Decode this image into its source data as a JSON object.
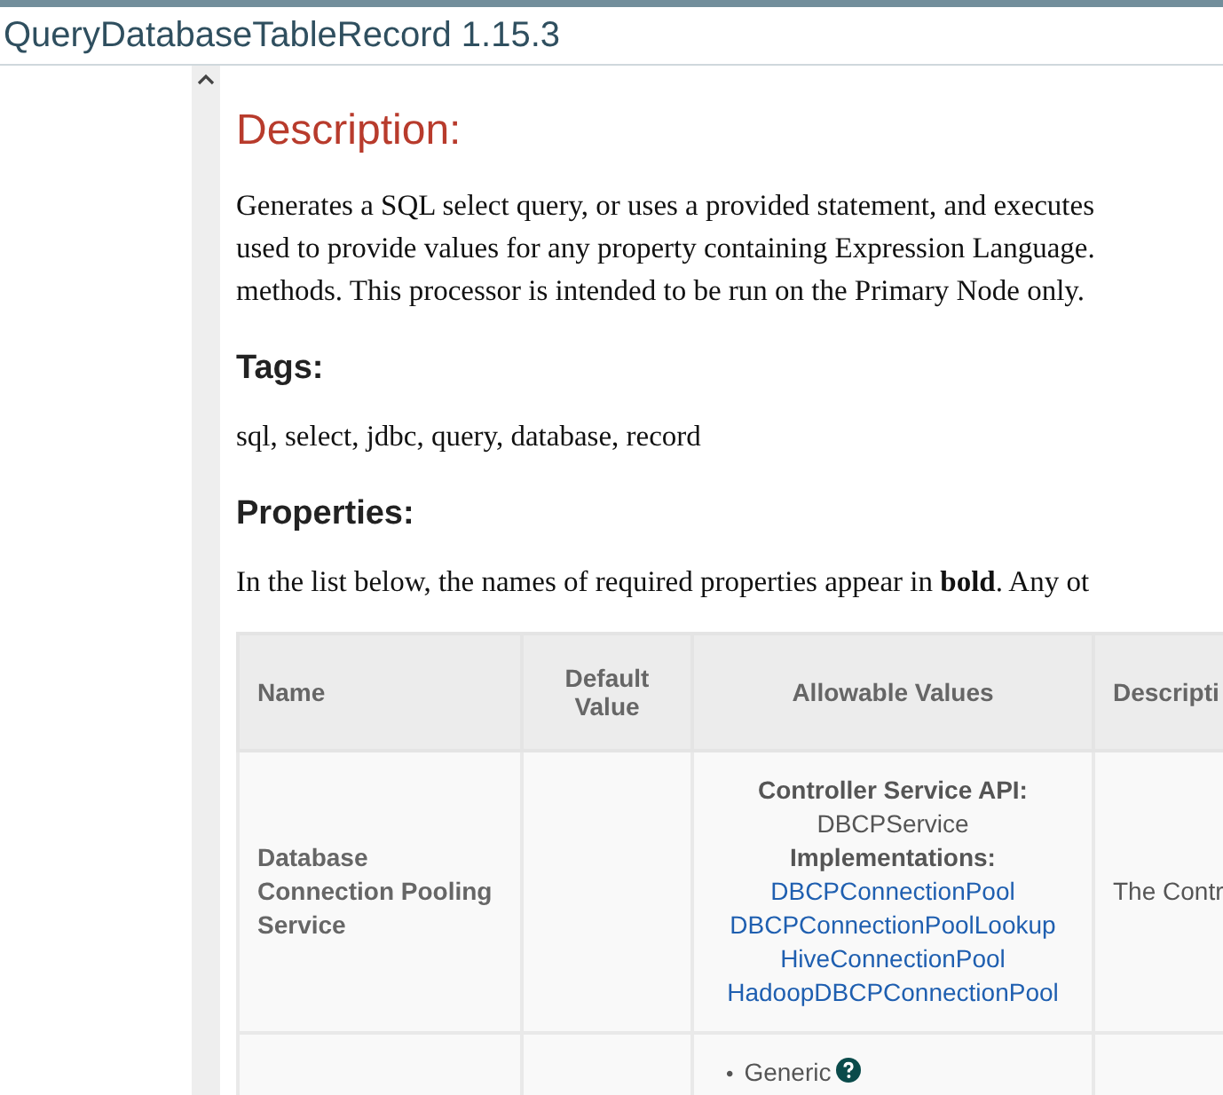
{
  "title": "QueryDatabaseTableRecord 1.15.3",
  "description": {
    "heading": "Description:",
    "lines": [
      "Generates a SQL select query, or uses a provided statement, and executes",
      "used to provide values for any property containing Expression Language.",
      "methods. This processor is intended to be run on the Primary Node only."
    ]
  },
  "tags": {
    "heading": "Tags:",
    "text": "sql, select, jdbc, query, database, record"
  },
  "properties": {
    "heading": "Properties:",
    "intro": "In the list below, the names of required properties appear in **bold**. Any ot",
    "table": {
      "columns": [
        "Name",
        "Default Value",
        "Allowable Values",
        "Descripti"
      ],
      "rows": [
        {
          "name": "Database Connection Pooling Service",
          "required": true,
          "allowable": {
            "kind": "service",
            "api_label": "Controller Service API:",
            "api": "DBCPService",
            "impl_label": "Implementations:",
            "implementations": [
              "DBCPConnectionPool",
              "DBCPConnectionPoolLookup",
              "HiveConnectionPool",
              "HadoopDBCPConnectionPool"
            ]
          },
          "description": "The Contr"
        },
        {
          "allowable": {
            "kind": "list",
            "items": [
              {
                "bullet": "•",
                "text": "Generic",
                "help": true
              }
            ]
          }
        }
      ]
    }
  }
}
